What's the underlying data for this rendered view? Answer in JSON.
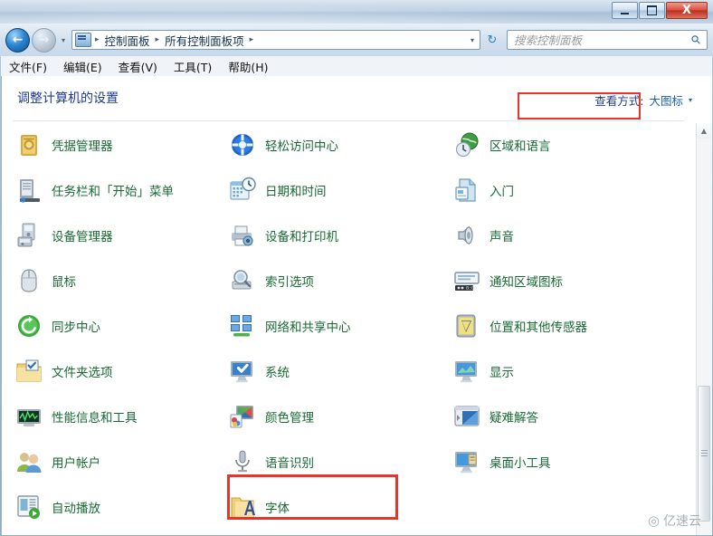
{
  "window": {
    "controls": {
      "minimize": "minimize",
      "maximize": "maximize",
      "close": "X"
    }
  },
  "nav": {
    "back_arrow": "←",
    "forward_arrow": "→",
    "history_caret": "▾",
    "breadcrumbs": [
      "控制面板",
      "所有控制面板项"
    ],
    "separator": "▸",
    "address_caret": "▾",
    "refresh_glyph": "↻"
  },
  "search": {
    "placeholder": "搜索控制面板",
    "value": "",
    "icon_glyph": "⚲"
  },
  "menubar": {
    "items": [
      "文件(F)",
      "编辑(E)",
      "查看(V)",
      "工具(T)",
      "帮助(H)"
    ]
  },
  "page": {
    "title": "调整计算机的设置",
    "view_by_label": "查看方式:",
    "view_by_value": "大图标",
    "view_by_caret": "▾"
  },
  "colors": {
    "heading": "#1d3a8f",
    "item_label": "#176a33",
    "annotation": "#e8342a",
    "link": "#1d5fb0"
  },
  "items": [
    {
      "label": "凭据管理器",
      "icon": "credential-manager-icon",
      "col": 0,
      "row": 0
    },
    {
      "label": "轻松访问中心",
      "icon": "ease-of-access-icon",
      "col": 1,
      "row": 0
    },
    {
      "label": "区域和语言",
      "icon": "region-language-icon",
      "col": 2,
      "row": 0
    },
    {
      "label": "任务栏和「开始」菜单",
      "icon": "taskbar-start-menu-icon",
      "col": 0,
      "row": 1
    },
    {
      "label": "日期和时间",
      "icon": "date-time-icon",
      "col": 1,
      "row": 1
    },
    {
      "label": "入门",
      "icon": "getting-started-icon",
      "col": 2,
      "row": 1
    },
    {
      "label": "设备管理器",
      "icon": "device-manager-icon",
      "col": 0,
      "row": 2
    },
    {
      "label": "设备和打印机",
      "icon": "devices-printers-icon",
      "col": 1,
      "row": 2
    },
    {
      "label": "声音",
      "icon": "sound-icon",
      "col": 2,
      "row": 2
    },
    {
      "label": "鼠标",
      "icon": "mouse-icon",
      "col": 0,
      "row": 3
    },
    {
      "label": "索引选项",
      "icon": "indexing-options-icon",
      "col": 1,
      "row": 3
    },
    {
      "label": "通知区域图标",
      "icon": "notification-area-icon",
      "col": 2,
      "row": 3
    },
    {
      "label": "同步中心",
      "icon": "sync-center-icon",
      "col": 0,
      "row": 4
    },
    {
      "label": "网络和共享中心",
      "icon": "network-sharing-icon",
      "col": 1,
      "row": 4
    },
    {
      "label": "位置和其他传感器",
      "icon": "location-sensors-icon",
      "col": 2,
      "row": 4
    },
    {
      "label": "文件夹选项",
      "icon": "folder-options-icon",
      "col": 0,
      "row": 5
    },
    {
      "label": "系统",
      "icon": "system-icon",
      "col": 1,
      "row": 5,
      "highlighted": true
    },
    {
      "label": "显示",
      "icon": "display-icon",
      "col": 2,
      "row": 5
    },
    {
      "label": "性能信息和工具",
      "icon": "performance-tools-icon",
      "col": 0,
      "row": 6
    },
    {
      "label": "颜色管理",
      "icon": "color-management-icon",
      "col": 1,
      "row": 6
    },
    {
      "label": "疑难解答",
      "icon": "troubleshooting-icon",
      "col": 2,
      "row": 6
    },
    {
      "label": "用户帐户",
      "icon": "user-accounts-icon",
      "col": 0,
      "row": 7
    },
    {
      "label": "语音识别",
      "icon": "speech-recognition-icon",
      "col": 1,
      "row": 7
    },
    {
      "label": "桌面小工具",
      "icon": "desktop-gadgets-icon",
      "col": 2,
      "row": 7
    },
    {
      "label": "自动播放",
      "icon": "autoplay-icon",
      "col": 0,
      "row": 8
    },
    {
      "label": "字体",
      "icon": "fonts-icon",
      "col": 1,
      "row": 8
    }
  ],
  "scrollbar": {
    "up_glyph": "▲"
  },
  "watermark": {
    "cloud_glyph": "◎",
    "text": "亿速云"
  }
}
